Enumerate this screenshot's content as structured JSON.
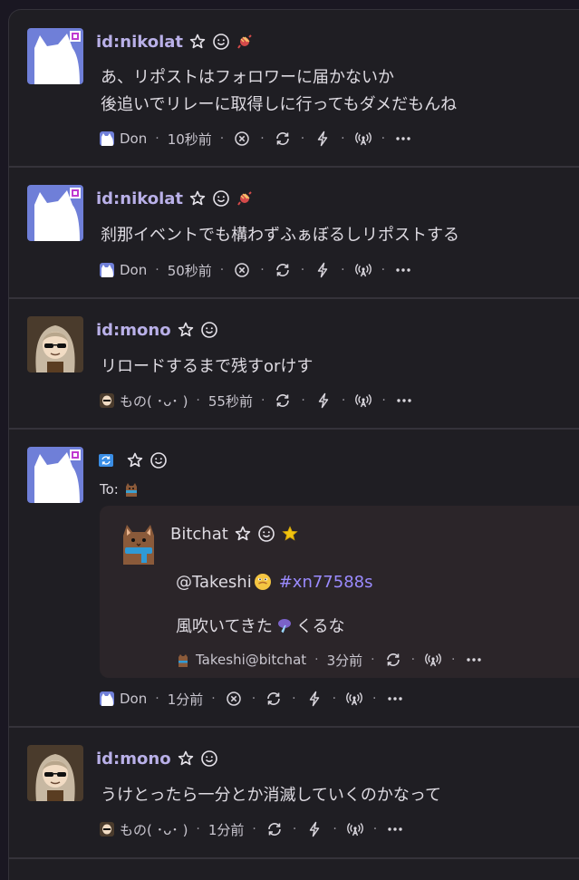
{
  "posts": [
    {
      "name": "id:nikolat",
      "content": "あ、リポストはフォロワーに届かないか\n後追いでリレーに取得しに行ってもダメだもんね",
      "client": "Don",
      "time": "10秒前"
    },
    {
      "name": "id:nikolat",
      "content": "刹那イベントでも構わずふぁぼるしリポストする",
      "client": "Don",
      "time": "50秒前"
    },
    {
      "name": "id:mono",
      "content": "リロードするまで残すorけす",
      "client": "もの( ･ᴗ･ )",
      "time": "55秒前"
    },
    {
      "to_label": "To:",
      "client": "Don",
      "time": "1分前",
      "quote": {
        "name": "Bitchat",
        "mention": "@Takeshi",
        "hashtag": "#xn77588s",
        "content": "風吹いてきた",
        "content_tail": "くるな",
        "client": "Takeshi@bitchat",
        "time": "3分前"
      }
    },
    {
      "name": "id:mono",
      "content": "うけとったら一分とか消滅していくのかなって",
      "client": "もの( ･ᴗ･ )",
      "time": "1分前"
    }
  ],
  "colors": {
    "accent": "#b9b0e8",
    "hashtag": "#9b8bff",
    "background": "#1f1e23",
    "star": "#f1c40f"
  }
}
